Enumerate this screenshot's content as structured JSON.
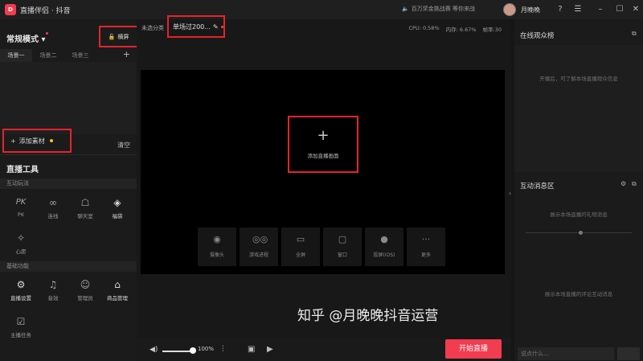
{
  "titlebar": {
    "logo_text": "D",
    "app_name": "直播伴侣 · 抖音",
    "notice": "百万奖金挑战赛 等你来战",
    "username": "月晚晚",
    "icons": [
      "speaker-icon",
      "help-icon",
      "menu-icon",
      "minimize-icon",
      "maximize-icon",
      "close-icon"
    ]
  },
  "left": {
    "mode_title": "常规模式",
    "portrait_label": "横屏",
    "scene_tabs": [
      "场景一",
      "场景二",
      "场景三"
    ],
    "add_material": "添加素材",
    "clear": "清空",
    "tools_title": "直播工具",
    "interactive_subhead": "互动玩法",
    "interactive_tools": [
      {
        "label": "PK",
        "icon": "pk-icon"
      },
      {
        "label": "连线",
        "icon": "link-icon"
      },
      {
        "label": "聊天室",
        "icon": "chatroom-icon"
      },
      {
        "label": "福袋",
        "icon": "lucky-bag-icon"
      },
      {
        "label": "心愿",
        "icon": "wish-icon"
      }
    ],
    "basic_subhead": "基础功能",
    "basic_tools": [
      {
        "label": "直播设置",
        "icon": "settings-icon"
      },
      {
        "label": "音效",
        "icon": "sound-effect-icon"
      },
      {
        "label": "管理员",
        "icon": "admin-icon"
      },
      {
        "label": "商品管理",
        "icon": "shop-icon"
      },
      {
        "label": "主播任务",
        "icon": "task-icon"
      }
    ]
  },
  "center": {
    "category": "未选分类",
    "title": "单场过200...",
    "stats": {
      "cpu": "CPU: 0.58%",
      "memory": "内存: 6.67%",
      "fps": "帧率:30"
    },
    "add_screen": "添加直播画面",
    "sources": [
      {
        "label": "摄像头",
        "icon": "camera-icon"
      },
      {
        "label": "游戏进程",
        "icon": "gamepad-icon"
      },
      {
        "label": "全屏",
        "icon": "monitor-icon"
      },
      {
        "label": "窗口",
        "icon": "window-icon"
      },
      {
        "label": "投屏(iOS)",
        "icon": "apple-icon"
      },
      {
        "label": "更多",
        "icon": "more-icon"
      }
    ],
    "volume": "100%",
    "start_button": "开始直播",
    "watermark": "知乎 @月晚晚抖音运营"
  },
  "right": {
    "audience_title": "在线观众榜",
    "audience_empty": "开播后，可了解本场直播观众信息",
    "messages_title": "互动消息区",
    "gift_empty": "展示本场直播的礼物消息",
    "comment_empty": "展示本场直播的评论互动消息",
    "input_placeholder": "说点什么..."
  }
}
